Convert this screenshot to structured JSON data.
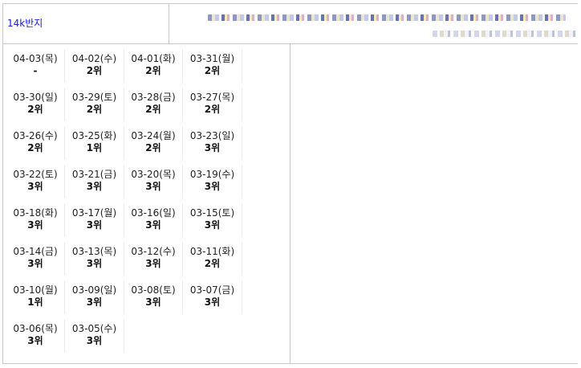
{
  "header": {
    "keyword": "14k반지"
  },
  "ranks": [
    {
      "date": "04-03(목)",
      "rank": "-"
    },
    {
      "date": "04-02(수)",
      "rank": "2위"
    },
    {
      "date": "04-01(화)",
      "rank": "2위"
    },
    {
      "date": "03-31(월)",
      "rank": "2위"
    },
    {
      "date": "03-30(일)",
      "rank": "2위"
    },
    {
      "date": "03-29(토)",
      "rank": "2위"
    },
    {
      "date": "03-28(금)",
      "rank": "2위"
    },
    {
      "date": "03-27(목)",
      "rank": "2위"
    },
    {
      "date": "03-26(수)",
      "rank": "2위"
    },
    {
      "date": "03-25(화)",
      "rank": "1위"
    },
    {
      "date": "03-24(월)",
      "rank": "2위"
    },
    {
      "date": "03-23(일)",
      "rank": "3위"
    },
    {
      "date": "03-22(토)",
      "rank": "3위"
    },
    {
      "date": "03-21(금)",
      "rank": "3위"
    },
    {
      "date": "03-20(목)",
      "rank": "3위"
    },
    {
      "date": "03-19(수)",
      "rank": "3위"
    },
    {
      "date": "03-18(화)",
      "rank": "3위"
    },
    {
      "date": "03-17(월)",
      "rank": "3위"
    },
    {
      "date": "03-16(일)",
      "rank": "3위"
    },
    {
      "date": "03-15(토)",
      "rank": "3위"
    },
    {
      "date": "03-14(금)",
      "rank": "3위"
    },
    {
      "date": "03-13(목)",
      "rank": "3위"
    },
    {
      "date": "03-12(수)",
      "rank": "3위"
    },
    {
      "date": "03-11(화)",
      "rank": "2위"
    },
    {
      "date": "03-10(월)",
      "rank": "1위"
    },
    {
      "date": "03-09(일)",
      "rank": "3위"
    },
    {
      "date": "03-08(토)",
      "rank": "3위"
    },
    {
      "date": "03-07(금)",
      "rank": "3위"
    },
    {
      "date": "03-06(목)",
      "rank": "3위"
    },
    {
      "date": "03-05(수)",
      "rank": "3위"
    }
  ],
  "colors": {
    "keyword_link": "#1a1ad6",
    "border": "#c8c8c8"
  }
}
